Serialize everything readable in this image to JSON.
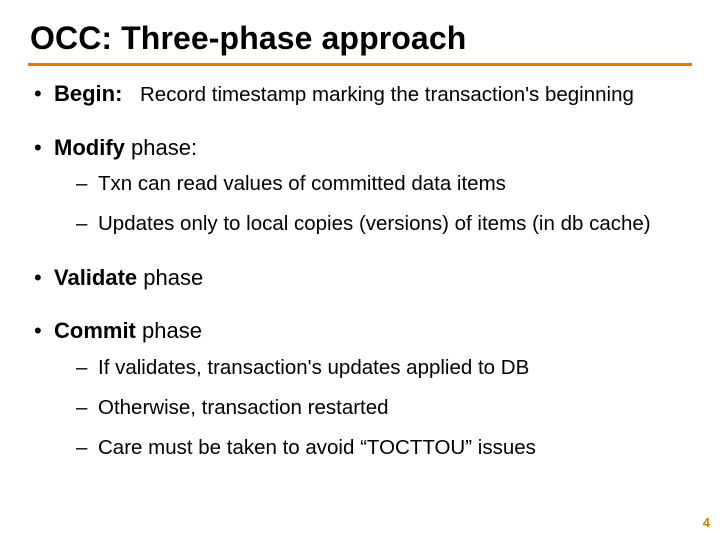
{
  "title": "OCC:  Three-phase approach",
  "bullets": {
    "begin": {
      "label": "Begin:",
      "desc": "Record timestamp marking the transaction's beginning"
    },
    "modify": {
      "label": "Modify",
      "rest": " phase:",
      "subs": [
        "Txn can read values of committed data items",
        "Updates only to local copies (versions) of items (in db cache)"
      ]
    },
    "validate": {
      "label": "Validate",
      "rest": " phase"
    },
    "commit": {
      "label": "Commit",
      "rest": " phase",
      "subs": [
        "If validates, transaction's updates applied to DB",
        "Otherwise, transaction restarted",
        "Care must be taken to avoid “TOCTTOU” issues"
      ]
    }
  },
  "page_number": "4"
}
